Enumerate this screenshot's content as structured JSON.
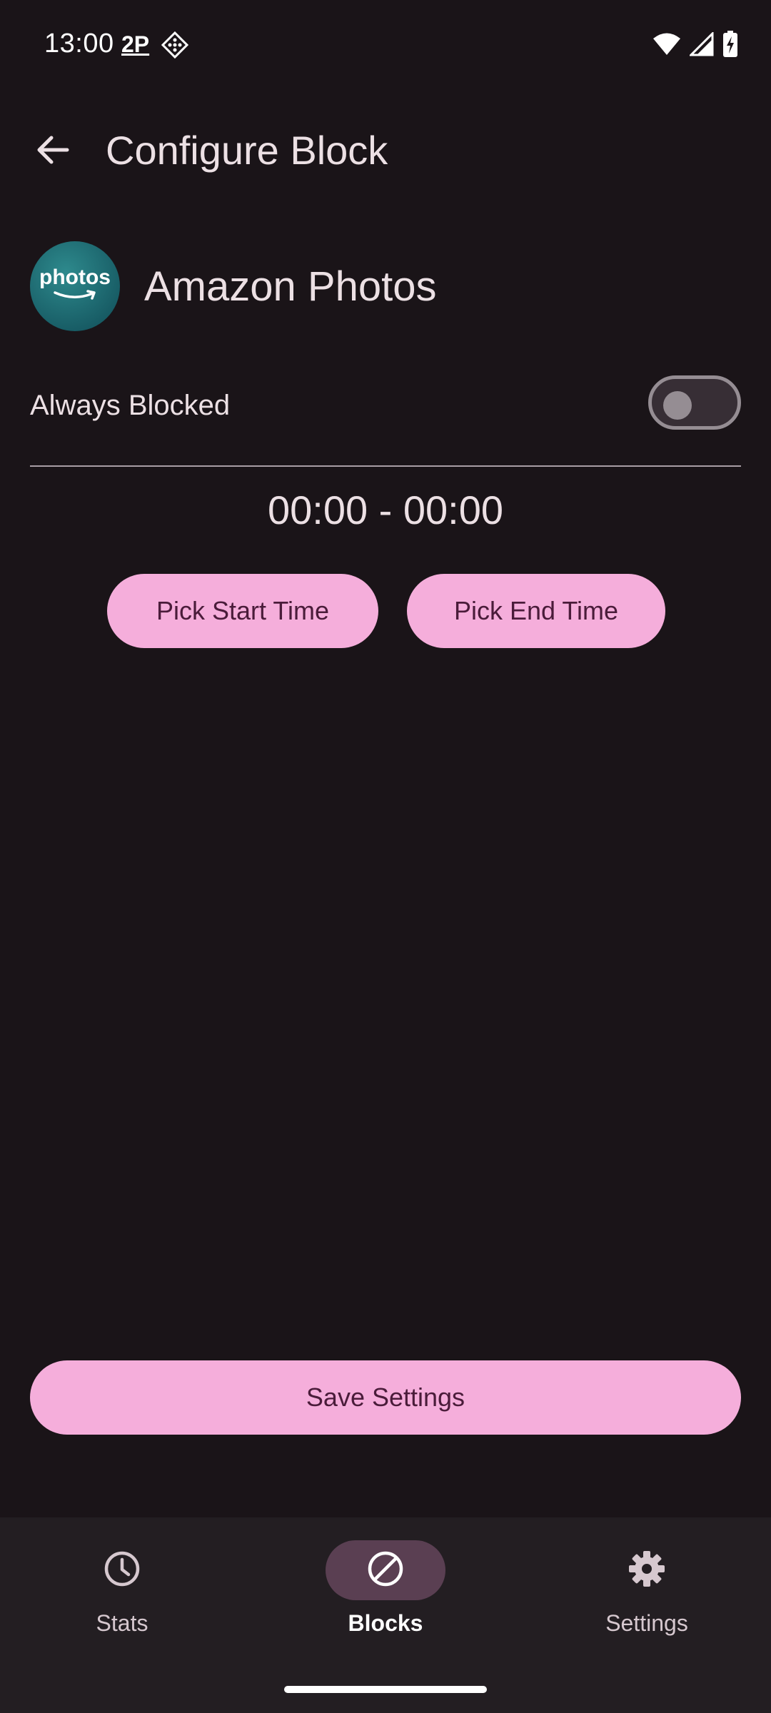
{
  "status_bar": {
    "time": "13:00",
    "badge": "2P",
    "icons": [
      "diamond-grid-icon",
      "wifi-icon",
      "signal-icon",
      "battery-charging-icon"
    ]
  },
  "app_bar": {
    "title": "Configure Block",
    "back_icon": "arrow-back-icon"
  },
  "app": {
    "name": "Amazon Photos",
    "icon_text": "photos"
  },
  "always_blocked": {
    "label": "Always Blocked",
    "enabled": false
  },
  "schedule": {
    "time_range": "00:00 - 00:00",
    "start_label": "Pick Start Time",
    "end_label": "Pick End Time"
  },
  "save": {
    "label": "Save Settings"
  },
  "bottom_nav": {
    "items": [
      {
        "label": "Stats",
        "icon": "clock-icon",
        "active": false
      },
      {
        "label": "Blocks",
        "icon": "block-icon",
        "active": true
      },
      {
        "label": "Settings",
        "icon": "gear-icon",
        "active": false
      }
    ]
  },
  "colors": {
    "background": "#1a1418",
    "accent": "#f5aedb",
    "accent_text": "#4a1c3a",
    "nav_background": "#231e22",
    "nav_active_pill": "#5a3f52"
  }
}
